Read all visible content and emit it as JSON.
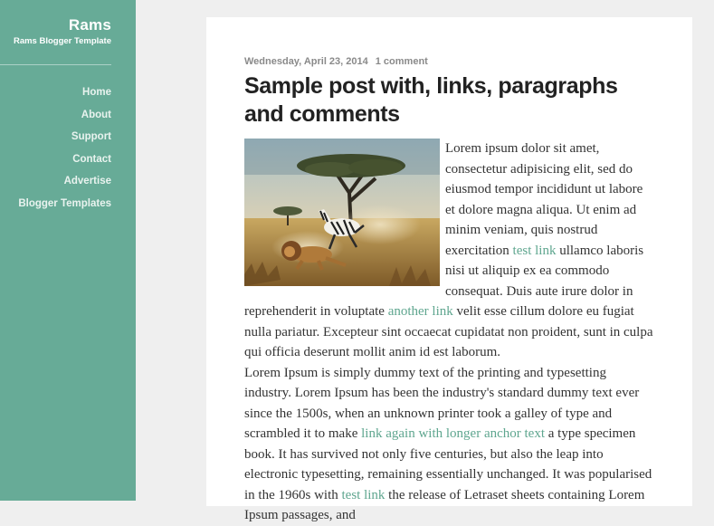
{
  "blog": {
    "title": "Rams",
    "tagline": "Rams Blogger Template"
  },
  "nav": {
    "items": [
      "Home",
      "About",
      "Support",
      "Contact",
      "Advertise",
      "Blogger Templates"
    ]
  },
  "post": {
    "date": "Wednesday, April 23, 2014",
    "comments": "1 comment",
    "title": "Sample post with, links, paragraphs and comments",
    "image_alt": "zebra-and-lion-savanna-image",
    "p1": {
      "t1": "Lorem ipsum dolor sit amet, consectetur adipisicing elit, sed do eiusmod tempor incididunt ut labore et dolore magna aliqua. Ut enim ad minim veniam, quis nostrud exercitation ",
      "link1": "test link",
      "t2": " ullamco laboris nisi ut aliquip ex ea commodo consequat. Duis aute irure dolor in reprehenderit in voluptate ",
      "link2": "another link",
      "t3": " velit esse cillum dolore eu fugiat nulla pariatur. Excepteur sint occaecat cupidatat non proident, sunt in culpa qui officia deserunt mollit anim id est laborum."
    },
    "p2": {
      "t1": "Lorem Ipsum is simply dummy text of the printing and typesetting industry. Lorem Ipsum has been the industry's standard dummy text ever since the 1500s, when an unknown printer took a galley of type and scrambled it to make ",
      "link1": "link again with longer anchor text",
      "t2": " a type specimen book. It has survived not only five centuries, but also the leap into electronic typesetting, remaining essentially unchanged. It was popularised in the 1960s with ",
      "link2": "test link",
      "t3": " the release of Letraset sheets containing Lorem Ipsum passages, and"
    }
  },
  "colors": {
    "sidebar": "#67ab97",
    "link": "#5fa68f",
    "background": "#efefef"
  }
}
